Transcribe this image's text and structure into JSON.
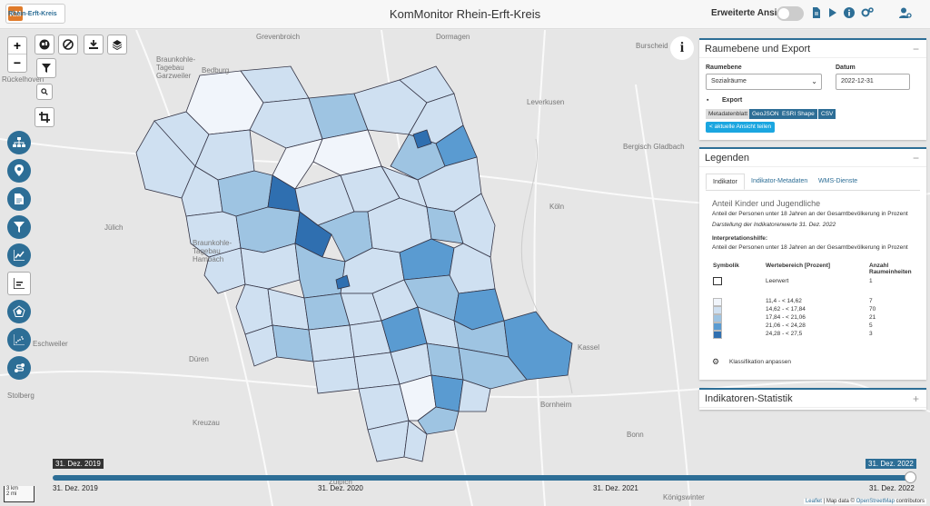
{
  "app": {
    "title": "KomMonitor Rhein-Erft-Kreis",
    "logo_text": "Rhein-Erft-Kreis",
    "logo_mark": "KM"
  },
  "header": {
    "extended_view_label": "Erweiterte Ansicht",
    "extended_view_on": false,
    "icons": [
      "document-icon",
      "play-icon",
      "info-icon",
      "settings-icon",
      "user-settings-icon"
    ]
  },
  "map": {
    "zoom_in": "+",
    "zoom_out": "−",
    "places": [
      {
        "name": "Grevenbroich"
      },
      {
        "name": "Dormagen"
      },
      {
        "name": "Burscheid"
      },
      {
        "name": "Bedburg"
      },
      {
        "name": "Leverkusen"
      },
      {
        "name": "Bergisch Gladbach"
      },
      {
        "name": "Köln"
      },
      {
        "name": "Jülich"
      },
      {
        "name": "Braunkohle-Tagebau Hambach"
      },
      {
        "name": "Braunkohle-Tagebau Garzweiler"
      },
      {
        "name": "Düren"
      },
      {
        "name": "Kreuzau"
      },
      {
        "name": "Bonn"
      },
      {
        "name": "Bornheim"
      },
      {
        "name": "Stolberg"
      },
      {
        "name": "Zülpich"
      },
      {
        "name": "Eschweiler"
      },
      {
        "name": "Kassel"
      },
      {
        "name": "Rückelhoven"
      },
      {
        "name": "Königswinter"
      }
    ],
    "scale": {
      "km": "3 km",
      "mi": "2 mi"
    },
    "attribution": {
      "leaflet": "Leaflet",
      "mid": " | Map data © ",
      "osm": "OpenStreetMap",
      "tail": " contributors"
    }
  },
  "raumebene": {
    "title": "Raumebene und Export",
    "level_label": "Raumebene",
    "level_value": "Sozialräume",
    "date_label": "Datum",
    "date_value": "2022-12-31",
    "export_label": "Export",
    "buttons": [
      "Metadatenblatt",
      "GeoJSON",
      "ESRI Shape",
      "CSV"
    ],
    "share_label": "aktuelle Ansicht teilen"
  },
  "legend": {
    "title": "Legenden",
    "tabs": [
      "Indikator",
      "Indikator-Metadaten",
      "WMS-Dienste"
    ],
    "indicator_name": "Anteil Kinder und Jugendliche",
    "indicator_desc": "Anteil der Personen unter 18 Jahren an der Gesamtbevölkerung in Prozent",
    "display_note": "Darstellung der Indikatorenwerte 31. Dez. 2022",
    "interp_label": "Interpretationshilfe:",
    "interp_text": "Anteil der Personen unter 18 Jahren an der Gesamtbevölkerung in Prozent",
    "col_symbol": "Symbolik",
    "col_range": "Wertebereich [Prozent]",
    "col_count_1": "Anzahl",
    "col_count_2": "Raumeinheiten",
    "empty_label": "Leerwert",
    "empty_count": "1",
    "classes": [
      {
        "range": "11,4 - < 14,62",
        "count": "7",
        "color": "#f1f5fb"
      },
      {
        "range": "14,62 - < 17,84",
        "count": "70",
        "color": "#cfe0f1"
      },
      {
        "range": "17,84 - < 21,06",
        "count": "21",
        "color": "#9ec4e2"
      },
      {
        "range": "21,06 - < 24,28",
        "count": "5",
        "color": "#5a9bd1"
      },
      {
        "range": "24,28 - < 27,5",
        "count": "3",
        "color": "#2f6fb0"
      }
    ],
    "classify_label": "Klassifikation anpassen"
  },
  "stats": {
    "title": "Indikatoren-Statistik"
  },
  "timeline": {
    "start_badge": "31. Dez. 2019",
    "end_badge": "31. Dez. 2022",
    "ticks": [
      "31. Dez. 2019",
      "31. Dez. 2020",
      "31. Dez. 2021",
      "31. Dez. 2022"
    ],
    "position": 1.0
  }
}
